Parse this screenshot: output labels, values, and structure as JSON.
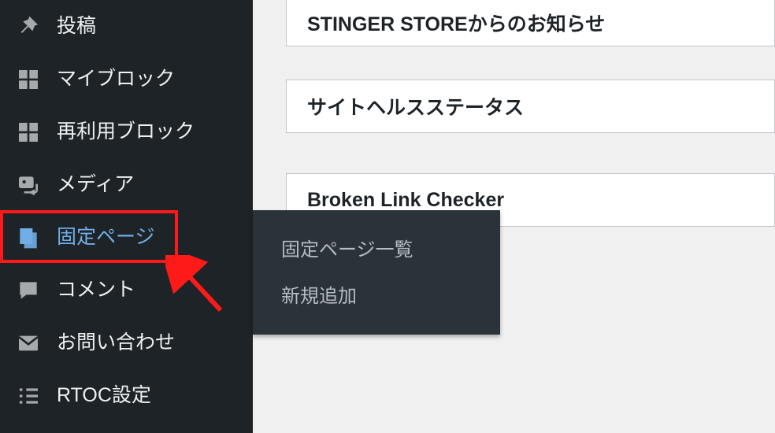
{
  "sidebar": {
    "items": [
      {
        "id": "posts",
        "label": "投稿"
      },
      {
        "id": "myblock",
        "label": "マイブロック"
      },
      {
        "id": "reuse",
        "label": "再利用ブロック"
      },
      {
        "id": "media",
        "label": "メディア"
      },
      {
        "id": "pages",
        "label": "固定ページ"
      },
      {
        "id": "comments",
        "label": "コメント"
      },
      {
        "id": "contact",
        "label": "お問い合わせ"
      },
      {
        "id": "rtoc",
        "label": "RTOC設定"
      }
    ]
  },
  "flyout": {
    "items": [
      {
        "id": "pages-list",
        "label": "固定ページ一覧"
      },
      {
        "id": "pages-new",
        "label": "新規追加"
      }
    ]
  },
  "panels": [
    {
      "id": "stinger",
      "title": "STINGER STOREからのお知らせ"
    },
    {
      "id": "health",
      "title": "サイトヘルスステータス"
    },
    {
      "id": "blc",
      "title": "Broken Link Checker"
    }
  ],
  "colors": {
    "sidebar_bg": "#1d2327",
    "flyout_bg": "#2c3338",
    "accent": "#72aee6",
    "highlight": "#ff1a1a"
  }
}
